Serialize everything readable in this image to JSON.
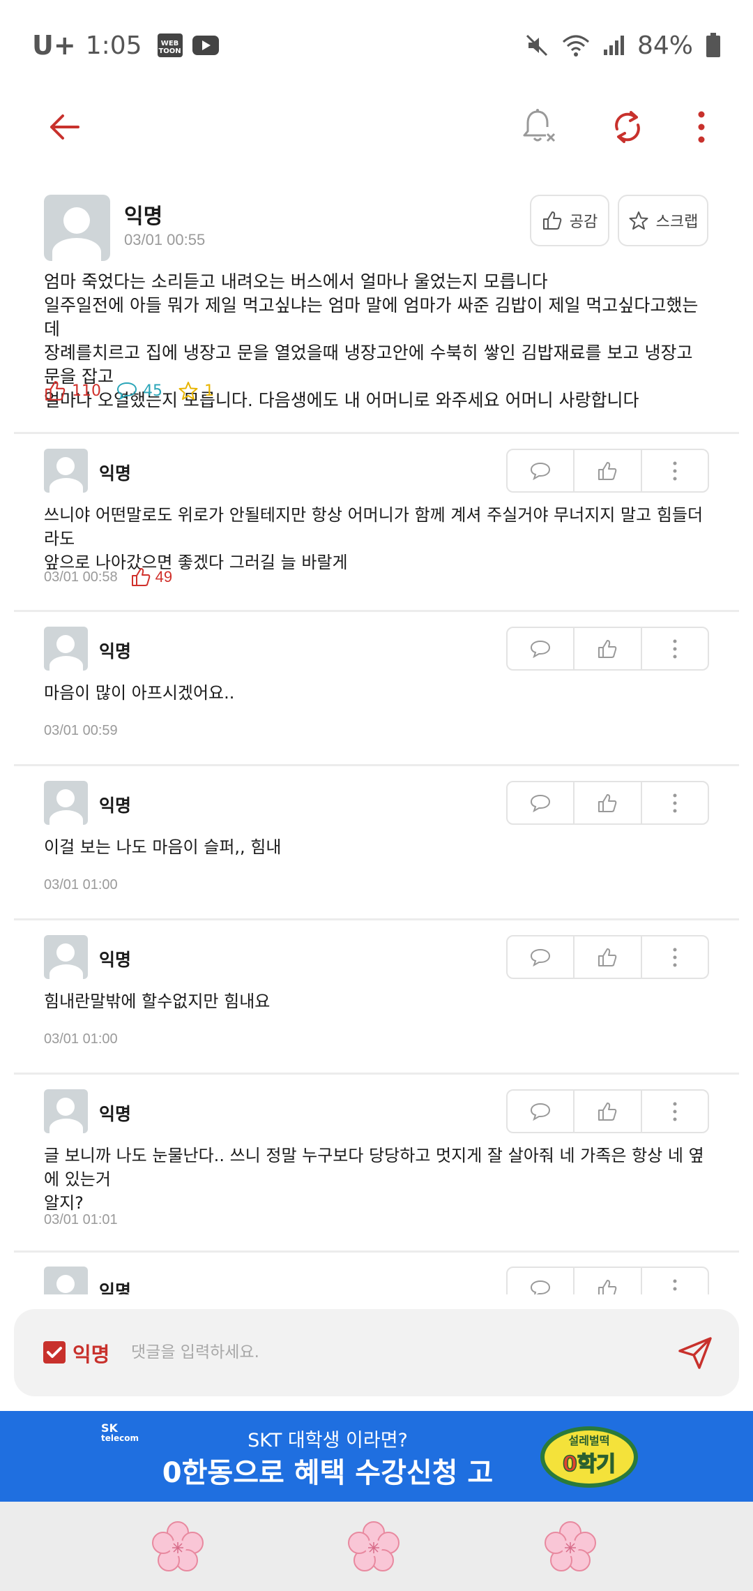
{
  "status_bar": {
    "carrier": "U+",
    "time": "1:05",
    "app_badge_webtoon": "WEB\nTOON",
    "battery": "84%"
  },
  "post": {
    "author": "익명",
    "time": "03/01 00:55",
    "empathy_label": "공감",
    "scrap_label": "스크랩",
    "body_lines": [
      "엄마 죽었다는 소리듣고 내려오는 버스에서 얼마나 울었는지 모릅니다",
      "일주일전에 아들 뭐가 제일 먹고싶냐는 엄마 말에 엄마가 싸준 김밥이 제일 먹고싶다고했는데",
      "장례를치르고 집에 냉장고 문을 열었을때 냉장고안에 수북히 쌓인 김밥재료를 보고 냉장고 문을 잡고",
      "얼마나 오열했는지 모릅니다. 다음생에도 내 어머니로 와주세요 어머니 사랑합니다"
    ],
    "likes": "110",
    "comments": "45",
    "scraps": "1"
  },
  "comments": [
    {
      "author": "익명",
      "body_lines": [
        "쓰니야 어떤말로도 위로가 안될테지만 항상 어머니가 함께 계셔 주실거야 무너지지 말고 힘들더라도",
        "앞으로 나아갔으면 좋겠다 그러길 늘 바랄게"
      ],
      "time": "03/01 00:58",
      "likes": "49"
    },
    {
      "author": "익명",
      "body_lines": [
        "마음이 많이 아프시겠어요.."
      ],
      "time": "03/01 00:59"
    },
    {
      "author": "익명",
      "body_lines": [
        "이걸 보는 나도 마음이 슬퍼,, 힘내"
      ],
      "time": "03/01 01:00"
    },
    {
      "author": "익명",
      "body_lines": [
        "힘내란말밖에 할수없지만 힘내요"
      ],
      "time": "03/01 01:00"
    },
    {
      "author": "익명",
      "body_lines": [
        "글 보니까 나도 눈물난다.. 쓰니 정말 누구보다 당당하고 멋지게 잘 살아줘 네 가족은 항상 네 옆에 있는거",
        "알지?"
      ],
      "time": "03/01 01:01"
    },
    {
      "author": "익명"
    }
  ],
  "input": {
    "anonymous_label": "익명",
    "anonymous_checked": true,
    "placeholder": "댓글을 입력하세요."
  },
  "ad": {
    "logo_top": "SK",
    "logo_bottom": "telecom",
    "line1": "SKT 대학생 이라면?",
    "line2": "0한동으로 혜택 수강신청 고",
    "badge_top": "설레벌떡",
    "badge_bottom": "0학기"
  },
  "colors": {
    "accent": "#c8312c",
    "like": "#d0302b",
    "comment": "#2aa5b8",
    "scrap": "#e8b400",
    "ad_bg": "#1f6fe0"
  }
}
